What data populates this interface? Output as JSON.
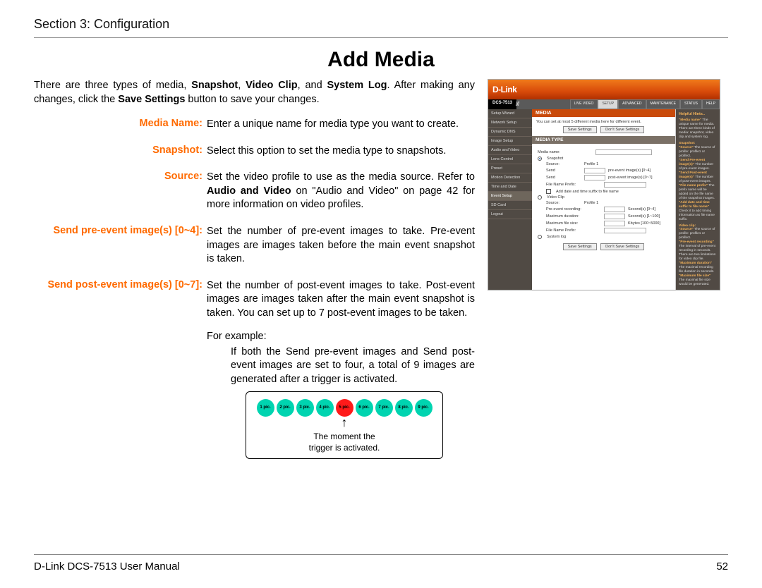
{
  "header": {
    "section": "Section 3: Configuration"
  },
  "title": "Add Media",
  "intro": {
    "t1": "There are three types of media, ",
    "b1": "Snapshot",
    "t2": ", ",
    "b2": "Video Clip",
    "t3": ", and ",
    "b3": "System Log",
    "t4": ". After making any changes, click the ",
    "b4": "Save Settings",
    "t5": " button to save your changes."
  },
  "defs": {
    "media_name": {
      "label": "Media Name:",
      "body": "Enter a unique name for media type you want to create."
    },
    "snapshot": {
      "label": "Snapshot:",
      "body": "Select this option to set the media type to snapshots."
    },
    "source": {
      "label": "Source:",
      "t1": "Set the video profile to use as the media source. Refer to ",
      "b1": "Audio and Video",
      "t2": " on \"Audio and Video\" on page 42 for more information on video profiles."
    },
    "pre": {
      "label": "Send pre-event image(s) [0~4]:",
      "body": "Set the number of pre-event images to take. Pre-event images are images taken before the main event snapshot is taken."
    },
    "post": {
      "label": "Send post-event image(s) [0~7]:",
      "body": "Set the number of post-event images to take. Post-event images are images taken after the main event snapshot is taken. You can set up to 7 post-event images to be taken.",
      "ex_label": "For example:",
      "ex_body": "If both the Send pre-event images and Send post-event images are set to four, a total of 9 images are generated after a trigger is activated."
    }
  },
  "diagram": {
    "dots": [
      "1 pic.",
      "2 pic.",
      "3 pic.",
      "4 pic.",
      "5 pic.",
      "6 pic.",
      "7 pic.",
      "8 pic.",
      "9 pic."
    ],
    "caption1": "The moment the",
    "caption2": "trigger is activated."
  },
  "shot": {
    "brand": "D-Link",
    "model": "DCS-7513",
    "tabs": [
      "LIVE VIDEO",
      "SETUP",
      "ADVANCED",
      "MAINTENANCE",
      "STATUS",
      "HELP"
    ],
    "active_tab": "SETUP",
    "side": [
      "Setup Wizard",
      "Network Setup",
      "Dynamic DNS",
      "Image Setup",
      "Audio and Video",
      "Lens Control",
      "Preset",
      "Motion Detection",
      "Time and Date",
      "Event Setup",
      "SD Card",
      "Logout"
    ],
    "side_selected": "Event Setup",
    "media_head": "MEDIA",
    "media_note": "You can set at most 5 different media here for different event.",
    "btn_save": "Save Settings",
    "btn_cancel": "Don't Save Settings",
    "type_head": "MEDIA TYPE",
    "f": {
      "media_name": "Media name:",
      "snapshot": "Snapshot",
      "source": "Source:",
      "source_val": "Profile 1",
      "send_pre": "Send",
      "send_pre_suffix": "pre-event image(s) [0~4]",
      "send_post": "Send",
      "send_post_suffix": "post-event image(s) [0~7]",
      "fname": "File Name Prefix:",
      "add_date": "Add date and time suffix to file name",
      "video": "Video Clip",
      "vsource": "Source:",
      "vsource_val": "Profile 1",
      "prerec": "Pre-event recording:",
      "prerec_suffix": "Second(s) [0~4]",
      "maxdur": "Maximum duration:",
      "maxdur_suffix": "Second(s) [1~100]",
      "maxsize": "Maximum file size:",
      "maxsize_suffix": "Kbytes [100~5000]",
      "vfname": "File Name Prefix:",
      "syslog": "System log"
    },
    "hints": {
      "head": "Helpful Hints..",
      "h1t": "\"Media name\"",
      "h1": " The unique name for media. There are three kinds of media: snapshot, video clip and system log.",
      "sh": "Snapshot:",
      "h2t": "\"Source\"",
      "h2": " The source of profile: profile1 or profile3.",
      "h3t": "\"Send Pre-event image(s)\"",
      "h3": " The number of pre-event images.",
      "h4t": "\"Send Post-event image(s)\"",
      "h4": " The number of post-event images.",
      "h5t": "\"File name prefix\"",
      "h5": " The prefix name will be added on the file name of the snapshot images.",
      "h6t": "\"Add date and time suffix to file name\"",
      "h6": " Check it to add timing information as file name suffix.",
      "vh": "Video clip:",
      "h7t": "\"Source\"",
      "h7": " The source of profile: profile1 or profile3.",
      "h8t": "\"Pre-event recording\"",
      "h8": " The interval of pre-event recording in seconds. There are two limitations for video clip file.",
      "h9t": "\"Maximum duration\"",
      "h9": " The maximal recording file duration in seconds.",
      "h10t": "\"Maximum file size\"",
      "h10": " The maximal file size would be generated."
    }
  },
  "footer": {
    "left": "D-Link DCS-7513 User Manual",
    "right": "52"
  }
}
